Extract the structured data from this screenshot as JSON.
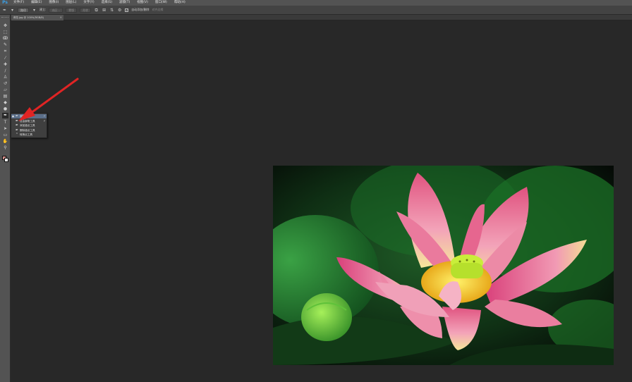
{
  "app": {
    "logo": "Ps"
  },
  "menubar": {
    "items": [
      "文件(F)",
      "编辑(E)",
      "图像(I)",
      "图层(L)",
      "文字(Y)",
      "选择(S)",
      "滤镜(T)",
      "视图(V)",
      "窗口(W)",
      "帮助(H)"
    ]
  },
  "options_bar": {
    "mode_label": "路径",
    "build_label": "建立:",
    "selection_label": "选区...",
    "mask_label": "蒙版",
    "shape_label": "形状",
    "auto_add_delete_label": "自动添加/删除",
    "align_edges_label": "对齐边缘"
  },
  "document": {
    "tab_title": "荷花.jpg @ 100%(RGB/8)",
    "tab_close": "×"
  },
  "tool_flyout": {
    "items": [
      {
        "label": "钢笔工具",
        "shortcut": "P",
        "icon": "pen-icon",
        "glyph": "✒",
        "selected": true,
        "mark": "■"
      },
      {
        "label": "自由钢笔工具",
        "shortcut": "P",
        "icon": "freeform-pen-icon",
        "glyph": "✒",
        "selected": false,
        "mark": ""
      },
      {
        "label": "添加锚点工具",
        "shortcut": "",
        "icon": "add-anchor-point-icon",
        "glyph": "✒",
        "selected": false,
        "mark": ""
      },
      {
        "label": "删除锚点工具",
        "shortcut": "",
        "icon": "delete-anchor-point-icon",
        "glyph": "✒",
        "selected": false,
        "mark": ""
      },
      {
        "label": "转换点工具",
        "shortcut": "",
        "icon": "convert-point-icon",
        "glyph": "⌃",
        "selected": false,
        "mark": ""
      }
    ]
  },
  "toolbar": {
    "tools": [
      {
        "name": "move-tool",
        "glyph": "✥"
      },
      {
        "name": "marquee-tool",
        "glyph": "⬚"
      },
      {
        "name": "lasso-tool",
        "glyph": "ↂ"
      },
      {
        "name": "quick-selection-tool",
        "glyph": "✎"
      },
      {
        "name": "crop-tool",
        "glyph": "⌗"
      },
      {
        "name": "eyedropper-tool",
        "glyph": "⁄"
      },
      {
        "name": "spot-healing-tool",
        "glyph": "✚"
      },
      {
        "name": "brush-tool",
        "glyph": "∕"
      },
      {
        "name": "clone-stamp-tool",
        "glyph": "♙"
      },
      {
        "name": "history-brush-tool",
        "glyph": "↺"
      },
      {
        "name": "eraser-tool",
        "glyph": "▱"
      },
      {
        "name": "gradient-tool",
        "glyph": "▤"
      },
      {
        "name": "blur-tool",
        "glyph": "◆"
      },
      {
        "name": "dodge-tool",
        "glyph": "●"
      },
      {
        "name": "pen-tool",
        "glyph": "✒"
      },
      {
        "name": "type-tool",
        "glyph": "T"
      },
      {
        "name": "path-selection-tool",
        "glyph": "➤"
      },
      {
        "name": "rectangle-tool",
        "glyph": "▭"
      },
      {
        "name": "hand-tool",
        "glyph": "✋"
      },
      {
        "name": "zoom-tool",
        "glyph": "⚲"
      }
    ],
    "colors": {
      "foreground": "#cf8b86",
      "background": "#f3f3f3"
    }
  },
  "colors": {
    "menubar_bg": "#535353",
    "workspace_bg": "#282828",
    "annotation_arrow": "#e02424",
    "flyout_selected": "#5b6f8a"
  }
}
